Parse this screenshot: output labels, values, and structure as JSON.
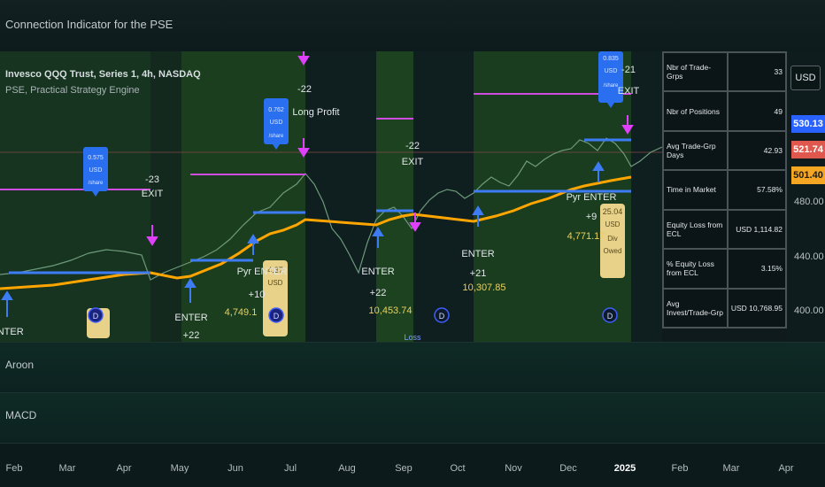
{
  "window": {
    "title": "Connection Indicator for the PSE"
  },
  "legend": {
    "symbol_line": "Invesco QQQ Trust, Series 1, 4h, NASDAQ",
    "indicator_line": "PSE, Practical Strategy Engine"
  },
  "currency_button": "USD",
  "price_tags": [
    {
      "value": "530.13",
      "color": "#2962ff"
    },
    {
      "value": "521.74",
      "color": "#e0584d"
    },
    {
      "value": "501.40",
      "color": "#f5a623"
    }
  ],
  "price_labels": [
    "480.00",
    "440.00",
    "400.00"
  ],
  "stats": [
    {
      "label": "Nbr of Trade-Grps",
      "value": "33"
    },
    {
      "label": "Nbr of Positions",
      "value": "49"
    },
    {
      "label": "Avg Trade-Grp Days",
      "value": "42.93"
    },
    {
      "label": "Time in Market",
      "value": "57.58%"
    },
    {
      "label": "Equity Loss from ECL",
      "value": "USD  1,114.82"
    },
    {
      "label": "% Equity Loss from ECL",
      "value": "3.15%"
    },
    {
      "label": "Avg Invest/Trade-Grp",
      "value": "USD  10,768.95"
    }
  ],
  "panes": [
    {
      "title": "Aroon"
    },
    {
      "title": "MACD"
    }
  ],
  "time_axis": [
    "Feb",
    "Mar",
    "Apr",
    "May",
    "Jun",
    "Jul",
    "Aug",
    "Sep",
    "Oct",
    "Nov",
    "Dec",
    "2025",
    "Feb",
    "Mar",
    "Apr"
  ],
  "annotations": {
    "enter": "ENTER",
    "exit": "EXIT",
    "pyr_enter": "Pyr ENTER",
    "long_profit": "Long Profit",
    "loss": "Loss",
    "usd": "USD",
    "shares": "/share",
    "div_marker": "D",
    "div_owed": [
      "Div",
      "Owed"
    ],
    "qty": {
      "a": "+22",
      "b": "+10",
      "c": "+22",
      "d": "+21",
      "e": "+9",
      "x1": "-23",
      "x2": "-22",
      "x3": "-22",
      "x4": "-21"
    },
    "amounts": {
      "a": "4,749.1",
      "b": "10,453.74",
      "c": "10,307.85",
      "d": "4,771.17",
      "e": "25.04",
      "f": "4.37"
    },
    "per_share": {
      "a": "0.575",
      "b": "0.762",
      "c": "0.835"
    }
  },
  "colors": {
    "up": "#26a69a",
    "down": "#ef5350",
    "entry_line": "#3d7cf5",
    "stop_line": "#ffa500",
    "exit_line": "#d04bdf",
    "label_bg": "#2a6ff0",
    "div_bg": "#e8d28a"
  }
}
